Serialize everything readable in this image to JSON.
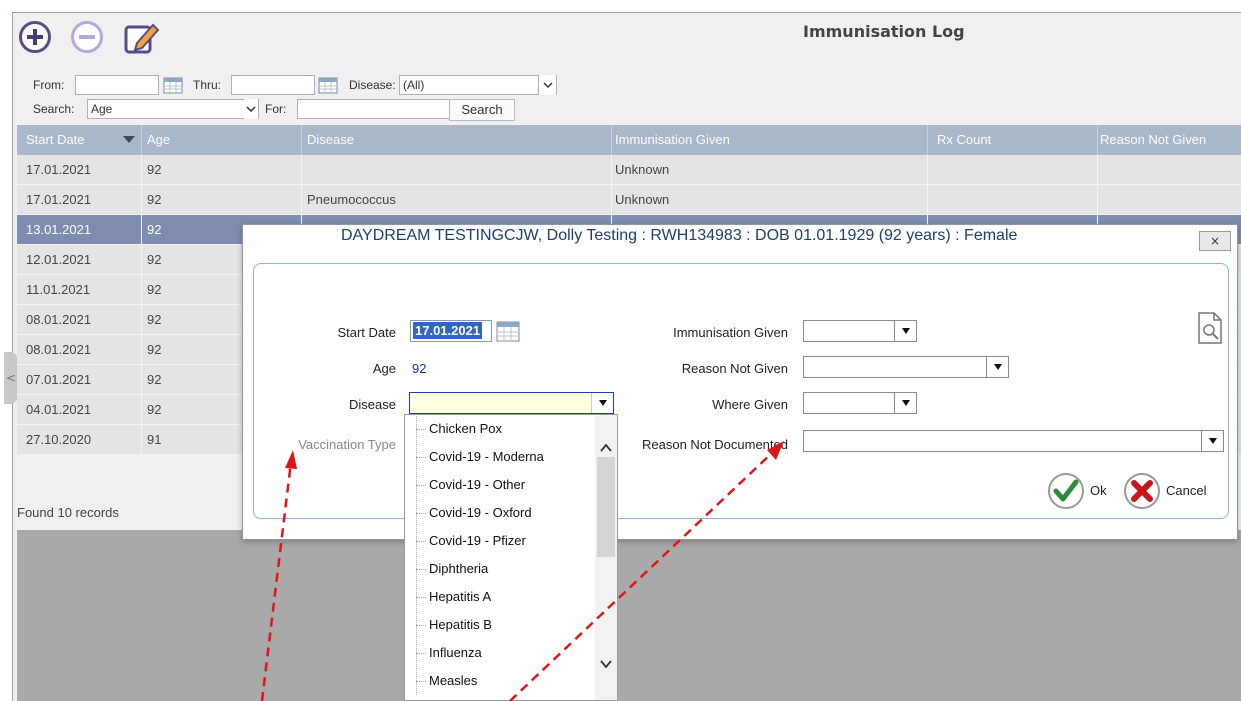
{
  "log": {
    "title": "Immunisation Log",
    "filters": {
      "from_label": "From:",
      "from_value": "",
      "thru_label": "Thru:",
      "thru_value": "",
      "disease_label": "Disease:",
      "disease_value": "(All)",
      "search_label": "Search:",
      "search_value": "Age",
      "for_label": "For:",
      "for_value": "",
      "search_button": "Search"
    },
    "columns": [
      "Start Date",
      "Age",
      "Disease",
      "Immunisation Given",
      "Rx Count",
      "Reason Not Given"
    ],
    "rows": [
      {
        "start_date": "17.01.2021",
        "age": "92",
        "disease": "",
        "given": "Unknown"
      },
      {
        "start_date": "17.01.2021",
        "age": "92",
        "disease": "Pneumococcus",
        "given": "Unknown"
      },
      {
        "start_date": "13.01.2021",
        "age": "92",
        "disease": "",
        "given": ""
      },
      {
        "start_date": "12.01.2021",
        "age": "92",
        "disease": "",
        "given": ""
      },
      {
        "start_date": "11.01.2021",
        "age": "92",
        "disease": "",
        "given": ""
      },
      {
        "start_date": "08.01.2021",
        "age": "92",
        "disease": "",
        "given": ""
      },
      {
        "start_date": "08.01.2021",
        "age": "92",
        "disease": "",
        "given": ""
      },
      {
        "start_date": "07.01.2021",
        "age": "92",
        "disease": "",
        "given": ""
      },
      {
        "start_date": "04.01.2021",
        "age": "92",
        "disease": "",
        "given": ""
      },
      {
        "start_date": "27.10.2020",
        "age": "91",
        "disease": "",
        "given": ""
      }
    ],
    "found_text": "Found 10 records",
    "side_tab": "<"
  },
  "dialog": {
    "title": "DAYDREAM TESTINGCJW, Dolly Testing : RWH134983 : DOB 01.01.1929 (92 years) : Female",
    "close_label": "×",
    "start_date_label": "Start Date",
    "start_date_value": "17.01.2021",
    "age_label": "Age",
    "age_value": "92",
    "disease_label": "Disease",
    "disease_value": "",
    "vaccination_type_label": "Vaccination Type",
    "immunisation_given_label": "Immunisation Given",
    "reason_not_given_label": "Reason Not Given",
    "where_given_label": "Where Given",
    "reason_not_documented_label": "Reason Not Documented",
    "ok_label": "Ok",
    "cancel_label": "Cancel"
  },
  "disease_options": [
    "Chicken Pox",
    "Covid-19 - Moderna",
    "Covid-19 - Other",
    "Covid-19 - Oxford",
    "Covid-19 - Pfizer",
    "Diphtheria",
    "Hepatitis A",
    "Hepatitis B",
    "Influenza",
    "Measles"
  ],
  "colors": {
    "header_bg": "#aab7cb",
    "selected_row": "#7e8cb2",
    "dialog_title": "#1d3f6e",
    "ok_check": "#2e8b3a",
    "cancel_x": "#c8161d",
    "annotation_arrow": "#e0141a"
  }
}
